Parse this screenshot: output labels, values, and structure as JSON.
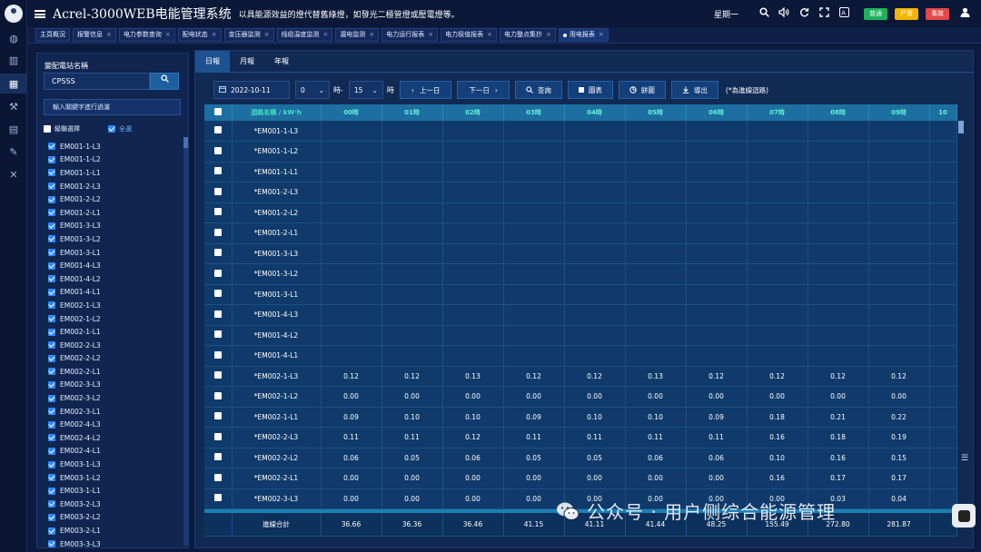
{
  "header": {
    "title": "Acrel-3000WEB电能管理系统",
    "subtitle": "以具能源效益的燈代替舊綠燈，如發光二極管燈或壓電燈等。",
    "weekday": "星期一",
    "badges": [
      {
        "label": "普通",
        "color": "#1db35a"
      },
      {
        "label": "严重",
        "color": "#f4b400"
      },
      {
        "label": "事故",
        "color": "#e54848"
      }
    ]
  },
  "tabs": [
    {
      "label": "主頁概況",
      "closable": false
    },
    {
      "label": "报警信息",
      "closable": true
    },
    {
      "label": "电力参数查询",
      "closable": true
    },
    {
      "label": "配电状态",
      "closable": true
    },
    {
      "label": "变压器监测",
      "closable": true
    },
    {
      "label": "线缆温度监测",
      "closable": true
    },
    {
      "label": "漏电监测",
      "closable": true
    },
    {
      "label": "电力运行报表",
      "closable": true
    },
    {
      "label": "电力极值报表",
      "closable": true
    },
    {
      "label": "电力整点集抄",
      "closable": true
    },
    {
      "label": "用电报表",
      "closable": true,
      "active": true
    }
  ],
  "left": {
    "station_label": "變配電站名稱",
    "station_value": "CPSSS",
    "filter_placeholder": "輸入關鍵字進行過濾",
    "cascade_label": "級聯選擇",
    "select_all_label": "全選",
    "items": [
      "EM001-1-L3",
      "EM001-1-L2",
      "EM001-1-L1",
      "EM001-2-L3",
      "EM001-2-L2",
      "EM001-2-L1",
      "EM001-3-L3",
      "EM001-3-L2",
      "EM001-3-L1",
      "EM001-4-L3",
      "EM001-4-L2",
      "EM001-4-L1",
      "EM002-1-L3",
      "EM002-1-L2",
      "EM002-1-L1",
      "EM002-2-L3",
      "EM002-2-L2",
      "EM002-2-L1",
      "EM002-3-L3",
      "EM002-3-L2",
      "EM002-3-L1",
      "EM002-4-L3",
      "EM002-4-L2",
      "EM002-4-L1",
      "EM003-1-L3",
      "EM003-1-L2",
      "EM003-1-L1",
      "EM003-2-L3",
      "EM003-2-L2",
      "EM003-2-L1",
      "EM003-3-L3"
    ]
  },
  "report": {
    "tabs": [
      "日報",
      "月報",
      "年報"
    ],
    "date": "2022-10-11",
    "hour": "0",
    "hour_suffix": "時-",
    "minute": "15",
    "minute_suffix": "時",
    "prev_day": "上一日",
    "next_day": "下一日",
    "query": "查詢",
    "chart": "圖表",
    "pie": "餅圖",
    "export": "導出",
    "note": "(*為進線迴路)",
    "columns": [
      "迴路名稱 / kW·h",
      "00時",
      "01時",
      "02時",
      "03時",
      "04時",
      "05時",
      "06時",
      "07時",
      "08時",
      "09時",
      "10"
    ],
    "rows": [
      {
        "name": "*EM001-1-L3",
        "values": [
          "",
          "",
          "",
          "",
          "",
          "",
          "",
          "",
          "",
          ""
        ]
      },
      {
        "name": "*EM001-1-L2",
        "values": [
          "",
          "",
          "",
          "",
          "",
          "",
          "",
          "",
          "",
          ""
        ]
      },
      {
        "name": "*EM001-1-L1",
        "values": [
          "",
          "",
          "",
          "",
          "",
          "",
          "",
          "",
          "",
          ""
        ]
      },
      {
        "name": "*EM001-2-L3",
        "values": [
          "",
          "",
          "",
          "",
          "",
          "",
          "",
          "",
          "",
          ""
        ]
      },
      {
        "name": "*EM001-2-L2",
        "values": [
          "",
          "",
          "",
          "",
          "",
          "",
          "",
          "",
          "",
          ""
        ]
      },
      {
        "name": "*EM001-2-L1",
        "values": [
          "",
          "",
          "",
          "",
          "",
          "",
          "",
          "",
          "",
          ""
        ]
      },
      {
        "name": "*EM001-3-L3",
        "values": [
          "",
          "",
          "",
          "",
          "",
          "",
          "",
          "",
          "",
          ""
        ]
      },
      {
        "name": "*EM001-3-L2",
        "values": [
          "",
          "",
          "",
          "",
          "",
          "",
          "",
          "",
          "",
          ""
        ]
      },
      {
        "name": "*EM001-3-L1",
        "values": [
          "",
          "",
          "",
          "",
          "",
          "",
          "",
          "",
          "",
          ""
        ]
      },
      {
        "name": "*EM001-4-L3",
        "values": [
          "",
          "",
          "",
          "",
          "",
          "",
          "",
          "",
          "",
          ""
        ]
      },
      {
        "name": "*EM001-4-L2",
        "values": [
          "",
          "",
          "",
          "",
          "",
          "",
          "",
          "",
          "",
          ""
        ]
      },
      {
        "name": "*EM001-4-L1",
        "values": [
          "",
          "",
          "",
          "",
          "",
          "",
          "",
          "",
          "",
          ""
        ]
      },
      {
        "name": "*EM002-1-L3",
        "values": [
          "0.12",
          "0.12",
          "0.13",
          "0.12",
          "0.12",
          "0.13",
          "0.12",
          "0.12",
          "0.12",
          "0.12"
        ]
      },
      {
        "name": "*EM002-1-L2",
        "values": [
          "0.00",
          "0.00",
          "0.00",
          "0.00",
          "0.00",
          "0.00",
          "0.00",
          "0.00",
          "0.00",
          "0.00"
        ]
      },
      {
        "name": "*EM002-1-L1",
        "values": [
          "0.09",
          "0.10",
          "0.10",
          "0.09",
          "0.10",
          "0.10",
          "0.09",
          "0.18",
          "0.21",
          "0.22"
        ]
      },
      {
        "name": "*EM002-2-L3",
        "values": [
          "0.11",
          "0.11",
          "0.12",
          "0.11",
          "0.11",
          "0.11",
          "0.11",
          "0.16",
          "0.18",
          "0.19"
        ]
      },
      {
        "name": "*EM002-2-L2",
        "values": [
          "0.06",
          "0.05",
          "0.06",
          "0.05",
          "0.05",
          "0.06",
          "0.06",
          "0.10",
          "0.16",
          "0.15"
        ]
      },
      {
        "name": "*EM002-2-L1",
        "values": [
          "0.00",
          "0.00",
          "0.00",
          "0.00",
          "0.00",
          "0.00",
          "0.00",
          "0.16",
          "0.17",
          "0.17"
        ]
      },
      {
        "name": "*EM002-3-L3",
        "values": [
          "0.00",
          "0.00",
          "0.00",
          "0.00",
          "0.00",
          "0.00",
          "0.00",
          "0.00",
          "0.03",
          "0.04"
        ]
      }
    ],
    "total_label": "進線合計",
    "totals": [
      "36.66",
      "36.36",
      "36.46",
      "41.15",
      "41.11",
      "41.44",
      "48.25",
      "155.49",
      "272.80",
      "281.87"
    ]
  },
  "watermark": "公众号 · 用户侧综合能源管理"
}
